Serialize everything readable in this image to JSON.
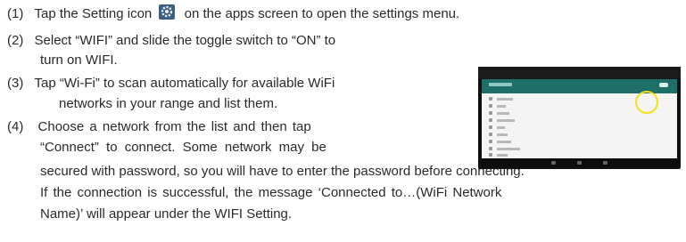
{
  "instructions": [
    {
      "num": "(1)",
      "before_icon": "Tap the Setting icon",
      "after_icon": "on the apps screen to open the settings menu."
    },
    {
      "num": "(2)",
      "line1": "Select “WIFI” and slide the toggle switch to “ON” to",
      "line2": "turn on WIFI."
    },
    {
      "num": "(3)",
      "line1": "Tap “Wi-Fi” to scan automatically for available WiFi",
      "line2": "networks in your range and list them."
    },
    {
      "num": "(4)",
      "line1": "Choose a network from the list and then tap",
      "line2": "“Connect” to connect. Some network may be",
      "line3": "secured with password, so you will have to enter the password before connecting.",
      "line4": "If the connection is successful, the message ‘Connected to…(WiFi Network",
      "line5": "Name)’ will appear under the WIFI Setting."
    }
  ],
  "icons": {
    "settings": "settings-gear-icon"
  },
  "colors": {
    "highlight_circle": "#f2e01a",
    "tablet_header": "#1e6e69"
  }
}
